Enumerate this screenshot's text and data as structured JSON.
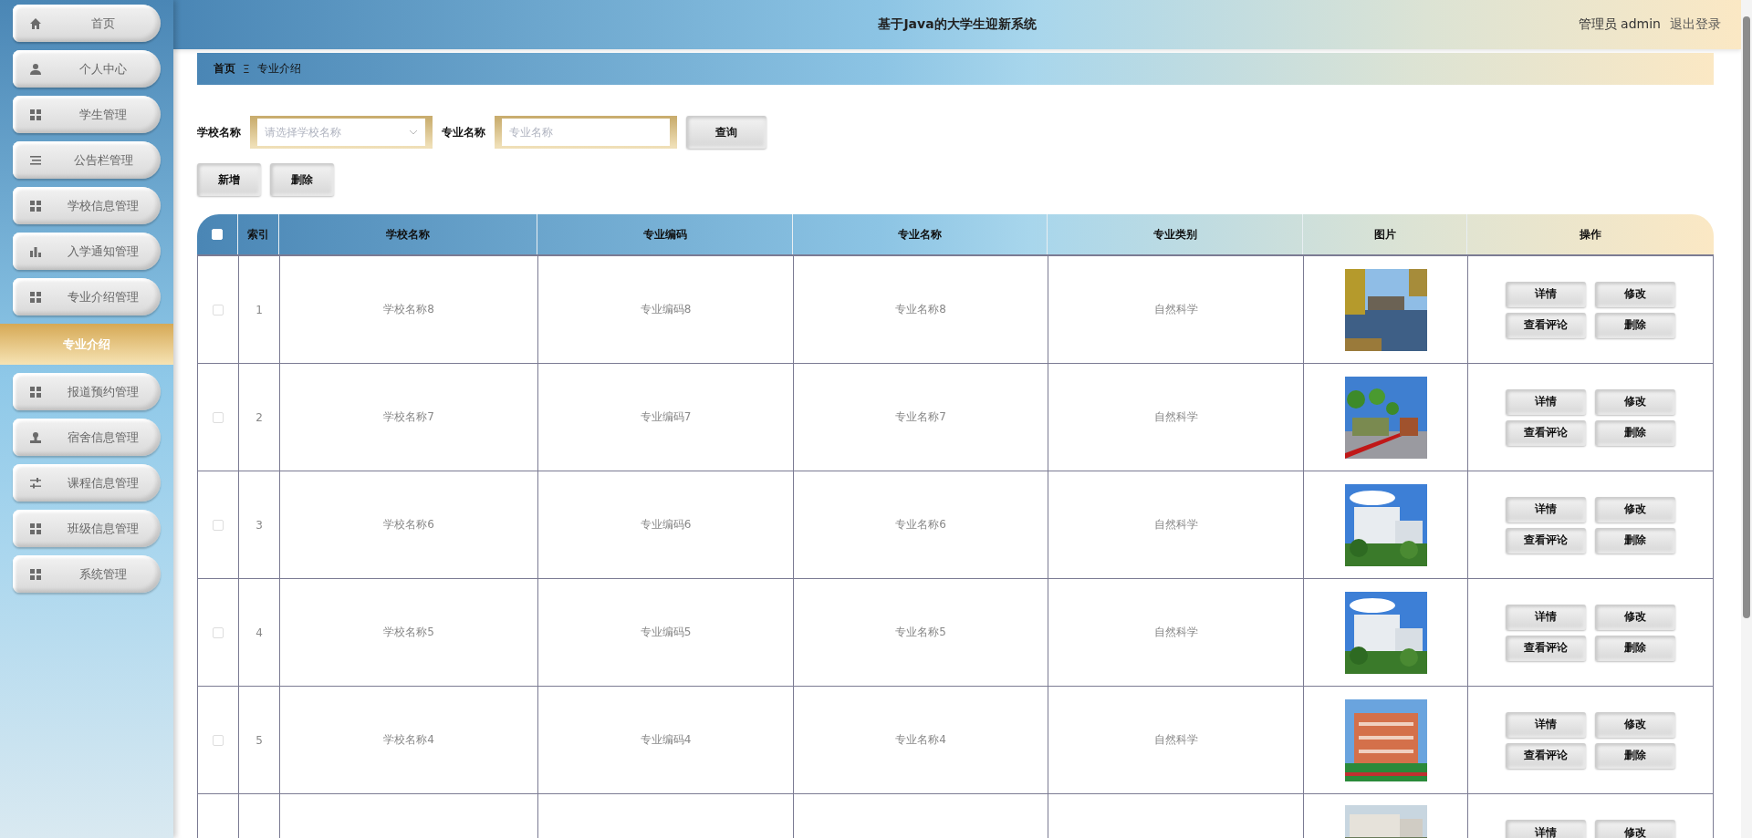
{
  "header": {
    "title": "基于Java的大学生迎新系统",
    "user": "管理员 admin",
    "logout": "退出登录"
  },
  "sidebar": {
    "items": [
      {
        "label": "首页",
        "selected": false
      },
      {
        "label": "个人中心",
        "selected": false
      },
      {
        "label": "学生管理",
        "selected": false
      },
      {
        "label": "公告栏管理",
        "selected": false
      },
      {
        "label": "学校信息管理",
        "selected": false
      },
      {
        "label": "入学通知管理",
        "selected": false
      },
      {
        "label": "专业介绍管理",
        "selected": false,
        "children": [
          {
            "label": "专业介绍",
            "selected": true
          }
        ]
      },
      {
        "label": "报道预约管理",
        "selected": false
      },
      {
        "label": "宿舍信息管理",
        "selected": false
      },
      {
        "label": "课程信息管理",
        "selected": false
      },
      {
        "label": "班级信息管理",
        "selected": false
      },
      {
        "label": "系统管理",
        "selected": false
      }
    ]
  },
  "breadcrumb": {
    "items": [
      "首页",
      "专业介绍"
    ],
    "separator": "Ξ"
  },
  "search": {
    "school_label": "学校名称",
    "school_placeholder": "请选择学校名称",
    "major_label": "专业名称",
    "major_placeholder": "专业名称",
    "button": "查询"
  },
  "actions": [
    "新增",
    "删除"
  ],
  "table": {
    "select_all_checked": false,
    "columns": [
      "索引",
      "学校名称",
      "专业编码",
      "专业名称",
      "专业类别",
      "图片",
      "操作"
    ],
    "rows": [
      {
        "checked": false,
        "index": "1",
        "school": "学校名称8",
        "code": "专业编码8",
        "name": "专业名称8",
        "category": "自然科学",
        "actions": [
          "详情",
          "修改",
          "查看评论",
          "删除"
        ]
      },
      {
        "checked": false,
        "index": "2",
        "school": "学校名称7",
        "code": "专业编码7",
        "name": "专业名称7",
        "category": "自然科学",
        "actions": [
          "详情",
          "修改",
          "查看评论",
          "删除"
        ]
      },
      {
        "checked": false,
        "index": "3",
        "school": "学校名称6",
        "code": "专业编码6",
        "name": "专业名称6",
        "category": "自然科学",
        "actions": [
          "详情",
          "修改",
          "查看评论",
          "删除"
        ]
      },
      {
        "checked": false,
        "index": "4",
        "school": "学校名称5",
        "code": "专业编码5",
        "name": "专业名称5",
        "category": "自然科学",
        "actions": [
          "详情",
          "修改",
          "查看评论",
          "删除"
        ]
      },
      {
        "checked": false,
        "index": "5",
        "school": "学校名称4",
        "code": "专业编码4",
        "name": "专业名称4",
        "category": "自然科学",
        "actions": [
          "详情",
          "修改",
          "查看评论",
          "删除"
        ]
      },
      {
        "actions": [
          "详情",
          "修改"
        ]
      }
    ]
  }
}
